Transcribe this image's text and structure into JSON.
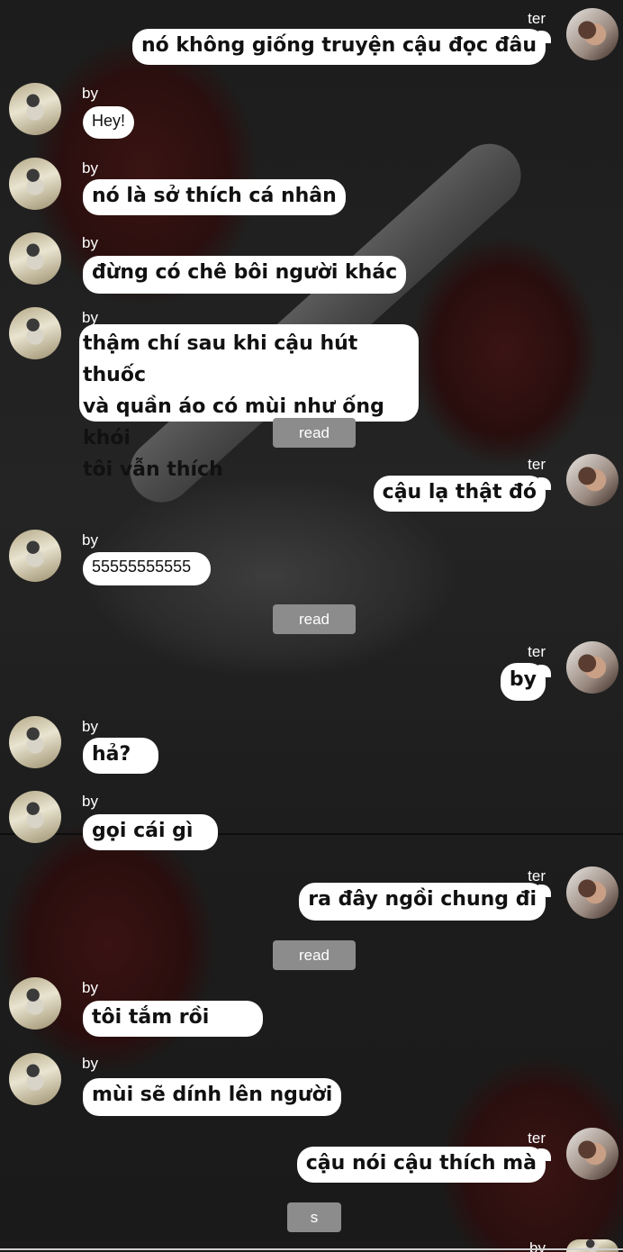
{
  "participants": {
    "left": {
      "name": "by"
    },
    "right": {
      "name": "ter"
    }
  },
  "messages": [
    {
      "from": "ter",
      "text": "nó không giống truyện cậu đọc đâu"
    },
    {
      "from": "by",
      "text": "Hey!"
    },
    {
      "from": "by",
      "text": "nó là sở thích cá nhân"
    },
    {
      "from": "by",
      "text": "đừng có chê bôi người khác"
    },
    {
      "from": "by",
      "lines": [
        "thậm chí sau khi cậu hút thuốc",
        "và quần áo có mùi như ống khói",
        "tôi vẫn thích"
      ]
    },
    {
      "from": "ter",
      "text": "cậu lạ thật đó"
    },
    {
      "from": "by",
      "text": "55555555555"
    },
    {
      "from": "ter",
      "text": "by"
    },
    {
      "from": "by",
      "text": "hả?"
    },
    {
      "from": "by",
      "text": "gọi cái gì"
    },
    {
      "from": "ter",
      "text": "ra đây ngồi chung đi"
    },
    {
      "from": "by",
      "text": "tôi tắm rồi"
    },
    {
      "from": "by",
      "text": "mùi sẽ dính lên người"
    },
    {
      "from": "ter",
      "text": "cậu nói cậu thích mà"
    }
  ],
  "status": {
    "read_label": "read",
    "s_label": "s"
  }
}
